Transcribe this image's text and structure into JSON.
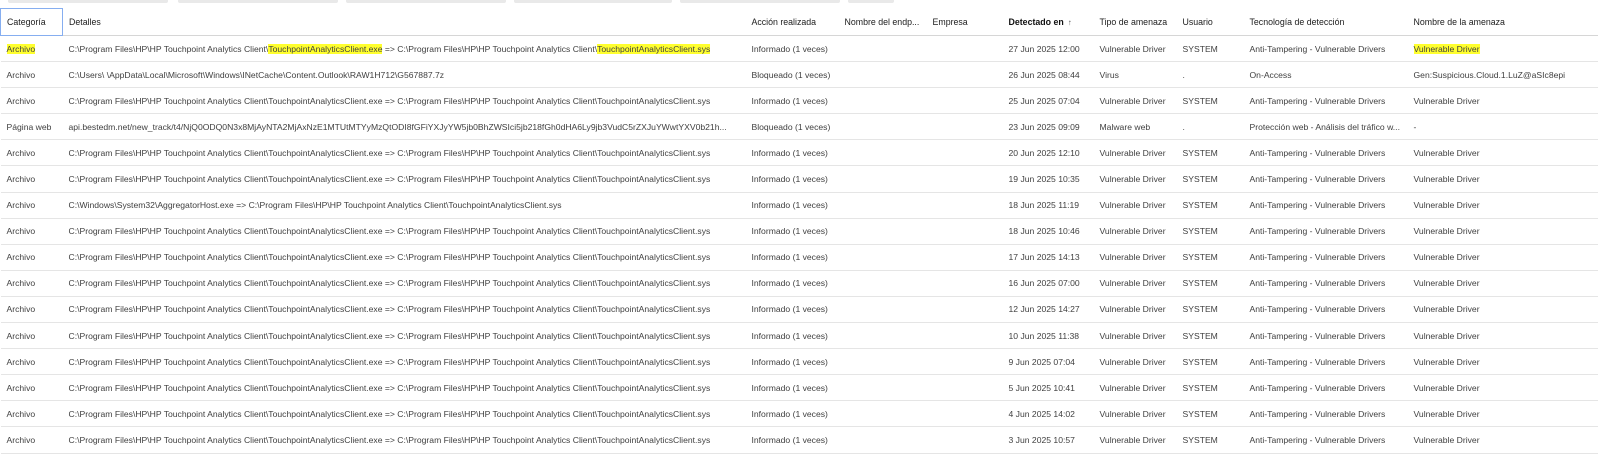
{
  "columns": {
    "categoria": "Categoría",
    "detalles": "Detalles",
    "accion": "Acción realizada",
    "endpoint": "Nombre del endp...",
    "empresa": "Empresa",
    "detectado": "Detectado en",
    "sort_indicator": "↑",
    "tipo": "Tipo de amenaza",
    "usuario": "Usuario",
    "tecnologia": "Tecnología de detección",
    "amenaza": "Nombre de la amenaza"
  },
  "highlight_color": "#ffff2e",
  "header_focus_color": "#86aef0",
  "rows": [
    {
      "categoria": "Archivo",
      "detalles_a": "C:\\Program Files\\HP\\HP Touchpoint Analytics Client\\",
      "detalles_b": "TouchpointAnalyticsClient.exe",
      "detalles_c": " => C:\\Program Files\\HP\\HP Touchpoint Analytics Client\\",
      "detalles_d": "TouchpointAnalyticsClient.sys",
      "accion": "Informado (1 veces)",
      "endpoint": "",
      "empresa": "",
      "detectado": "27 Jun 2025 12:00",
      "tipo": "Vulnerable Driver",
      "usuario": "SYSTEM",
      "tecnologia": "Anti-Tampering - Vulnerable Drivers",
      "amenaza": "Vulnerable Driver"
    },
    {
      "categoria": "Archivo",
      "detalles": "C:\\Users\\            \\AppData\\Local\\Microsoft\\Windows\\INetCache\\Content.Outlook\\RAW1H712\\G567887.7z",
      "accion": "Bloqueado (1 veces)",
      "endpoint": "",
      "empresa": "",
      "detectado": "26 Jun 2025 08:44",
      "tipo": "Virus",
      "usuario": ".",
      "tecnologia": "On-Access",
      "amenaza": "Gen:Suspicious.Cloud.1.LuZ@aSIc8epi"
    },
    {
      "categoria": "Archivo",
      "detalles": "C:\\Program Files\\HP\\HP Touchpoint Analytics Client\\TouchpointAnalyticsClient.exe => C:\\Program Files\\HP\\HP Touchpoint Analytics Client\\TouchpointAnalyticsClient.sys",
      "accion": "Informado (1 veces)",
      "endpoint": "",
      "empresa": "",
      "detectado": "25 Jun 2025 07:04",
      "tipo": "Vulnerable Driver",
      "usuario": "SYSTEM",
      "tecnologia": "Anti-Tampering - Vulnerable Drivers",
      "amenaza": "Vulnerable Driver"
    },
    {
      "categoria": "Página web",
      "detalles": "api.bestedm.net/new_track/t4/NjQ0ODQ0N3x8MjAyNTA2MjAxNzE1MTUtMTYyMzQtODI8fGFiYXJyYW5jb0BhZWSIci5jb218fGh0dHA6Ly9jb3VudC5rZXJuYWwtYXV0b21h...",
      "accion": "Bloqueado (1 veces)",
      "endpoint": "",
      "empresa": "",
      "detectado": "23 Jun 2025 09:09",
      "tipo": "Malware web",
      "usuario": ".",
      "tecnologia": "Protección web - Análisis del tráfico w...",
      "amenaza": "-"
    },
    {
      "categoria": "Archivo",
      "detalles": "C:\\Program Files\\HP\\HP Touchpoint Analytics Client\\TouchpointAnalyticsClient.exe => C:\\Program Files\\HP\\HP Touchpoint Analytics Client\\TouchpointAnalyticsClient.sys",
      "accion": "Informado (1 veces)",
      "endpoint": "",
      "empresa": "",
      "detectado": "20 Jun 2025 12:10",
      "tipo": "Vulnerable Driver",
      "usuario": "SYSTEM",
      "tecnologia": "Anti-Tampering - Vulnerable Drivers",
      "amenaza": "Vulnerable Driver"
    },
    {
      "categoria": "Archivo",
      "detalles": "C:\\Program Files\\HP\\HP Touchpoint Analytics Client\\TouchpointAnalyticsClient.exe => C:\\Program Files\\HP\\HP Touchpoint Analytics Client\\TouchpointAnalyticsClient.sys",
      "accion": "Informado (1 veces)",
      "endpoint": "",
      "empresa": "",
      "detectado": "19 Jun 2025 10:35",
      "tipo": "Vulnerable Driver",
      "usuario": "SYSTEM",
      "tecnologia": "Anti-Tampering - Vulnerable Drivers",
      "amenaza": "Vulnerable Driver"
    },
    {
      "categoria": "Archivo",
      "detalles": "C:\\Windows\\System32\\AggregatorHost.exe => C:\\Program Files\\HP\\HP Touchpoint Analytics Client\\TouchpointAnalyticsClient.sys",
      "accion": "Informado (1 veces)",
      "endpoint": "",
      "empresa": "",
      "detectado": "18 Jun 2025 11:19",
      "tipo": "Vulnerable Driver",
      "usuario": "SYSTEM",
      "tecnologia": "Anti-Tampering - Vulnerable Drivers",
      "amenaza": "Vulnerable Driver"
    },
    {
      "categoria": "Archivo",
      "detalles": "C:\\Program Files\\HP\\HP Touchpoint Analytics Client\\TouchpointAnalyticsClient.exe => C:\\Program Files\\HP\\HP Touchpoint Analytics Client\\TouchpointAnalyticsClient.sys",
      "accion": "Informado (1 veces)",
      "endpoint": "",
      "empresa": "",
      "detectado": "18 Jun 2025 10:46",
      "tipo": "Vulnerable Driver",
      "usuario": "SYSTEM",
      "tecnologia": "Anti-Tampering - Vulnerable Drivers",
      "amenaza": "Vulnerable Driver"
    },
    {
      "categoria": "Archivo",
      "detalles": "C:\\Program Files\\HP\\HP Touchpoint Analytics Client\\TouchpointAnalyticsClient.exe => C:\\Program Files\\HP\\HP Touchpoint Analytics Client\\TouchpointAnalyticsClient.sys",
      "accion": "Informado (1 veces)",
      "endpoint": "",
      "empresa": "",
      "detectado": "17 Jun 2025 14:13",
      "tipo": "Vulnerable Driver",
      "usuario": "SYSTEM",
      "tecnologia": "Anti-Tampering - Vulnerable Drivers",
      "amenaza": "Vulnerable Driver"
    },
    {
      "categoria": "Archivo",
      "detalles": "C:\\Program Files\\HP\\HP Touchpoint Analytics Client\\TouchpointAnalyticsClient.exe => C:\\Program Files\\HP\\HP Touchpoint Analytics Client\\TouchpointAnalyticsClient.sys",
      "accion": "Informado (1 veces)",
      "endpoint": "",
      "empresa": "",
      "detectado": "16 Jun 2025 07:00",
      "tipo": "Vulnerable Driver",
      "usuario": "SYSTEM",
      "tecnologia": "Anti-Tampering - Vulnerable Drivers",
      "amenaza": "Vulnerable Driver"
    },
    {
      "categoria": "Archivo",
      "detalles": "C:\\Program Files\\HP\\HP Touchpoint Analytics Client\\TouchpointAnalyticsClient.exe => C:\\Program Files\\HP\\HP Touchpoint Analytics Client\\TouchpointAnalyticsClient.sys",
      "accion": "Informado (1 veces)",
      "endpoint": "",
      "empresa": "",
      "detectado": "12 Jun 2025 14:27",
      "tipo": "Vulnerable Driver",
      "usuario": "SYSTEM",
      "tecnologia": "Anti-Tampering - Vulnerable Drivers",
      "amenaza": "Vulnerable Driver"
    },
    {
      "categoria": "Archivo",
      "detalles": "C:\\Program Files\\HP\\HP Touchpoint Analytics Client\\TouchpointAnalyticsClient.exe => C:\\Program Files\\HP\\HP Touchpoint Analytics Client\\TouchpointAnalyticsClient.sys",
      "accion": "Informado (1 veces)",
      "endpoint": "",
      "empresa": "",
      "detectado": "10 Jun 2025 11:38",
      "tipo": "Vulnerable Driver",
      "usuario": "SYSTEM",
      "tecnologia": "Anti-Tampering - Vulnerable Drivers",
      "amenaza": "Vulnerable Driver"
    },
    {
      "categoria": "Archivo",
      "detalles": "C:\\Program Files\\HP\\HP Touchpoint Analytics Client\\TouchpointAnalyticsClient.exe => C:\\Program Files\\HP\\HP Touchpoint Analytics Client\\TouchpointAnalyticsClient.sys",
      "accion": "Informado (1 veces)",
      "endpoint": "",
      "empresa": "",
      "detectado": "9 Jun 2025 07:04",
      "tipo": "Vulnerable Driver",
      "usuario": "SYSTEM",
      "tecnologia": "Anti-Tampering - Vulnerable Drivers",
      "amenaza": "Vulnerable Driver"
    },
    {
      "categoria": "Archivo",
      "detalles": "C:\\Program Files\\HP\\HP Touchpoint Analytics Client\\TouchpointAnalyticsClient.exe => C:\\Program Files\\HP\\HP Touchpoint Analytics Client\\TouchpointAnalyticsClient.sys",
      "accion": "Informado (1 veces)",
      "endpoint": "",
      "empresa": "",
      "detectado": "5 Jun 2025 10:41",
      "tipo": "Vulnerable Driver",
      "usuario": "SYSTEM",
      "tecnologia": "Anti-Tampering - Vulnerable Drivers",
      "amenaza": "Vulnerable Driver"
    },
    {
      "categoria": "Archivo",
      "detalles": "C:\\Program Files\\HP\\HP Touchpoint Analytics Client\\TouchpointAnalyticsClient.exe => C:\\Program Files\\HP\\HP Touchpoint Analytics Client\\TouchpointAnalyticsClient.sys",
      "accion": "Informado (1 veces)",
      "endpoint": "",
      "empresa": "",
      "detectado": "4 Jun 2025 14:02",
      "tipo": "Vulnerable Driver",
      "usuario": "SYSTEM",
      "tecnologia": "Anti-Tampering - Vulnerable Drivers",
      "amenaza": "Vulnerable Driver"
    },
    {
      "categoria": "Archivo",
      "detalles": "C:\\Program Files\\HP\\HP Touchpoint Analytics Client\\TouchpointAnalyticsClient.exe => C:\\Program Files\\HP\\HP Touchpoint Analytics Client\\TouchpointAnalyticsClient.sys",
      "accion": "Informado (1 veces)",
      "endpoint": "",
      "empresa": "",
      "detectado": "3 Jun 2025 10:57",
      "tipo": "Vulnerable Driver",
      "usuario": "SYSTEM",
      "tecnologia": "Anti-Tampering - Vulnerable Drivers",
      "amenaza": "Vulnerable Driver"
    }
  ]
}
